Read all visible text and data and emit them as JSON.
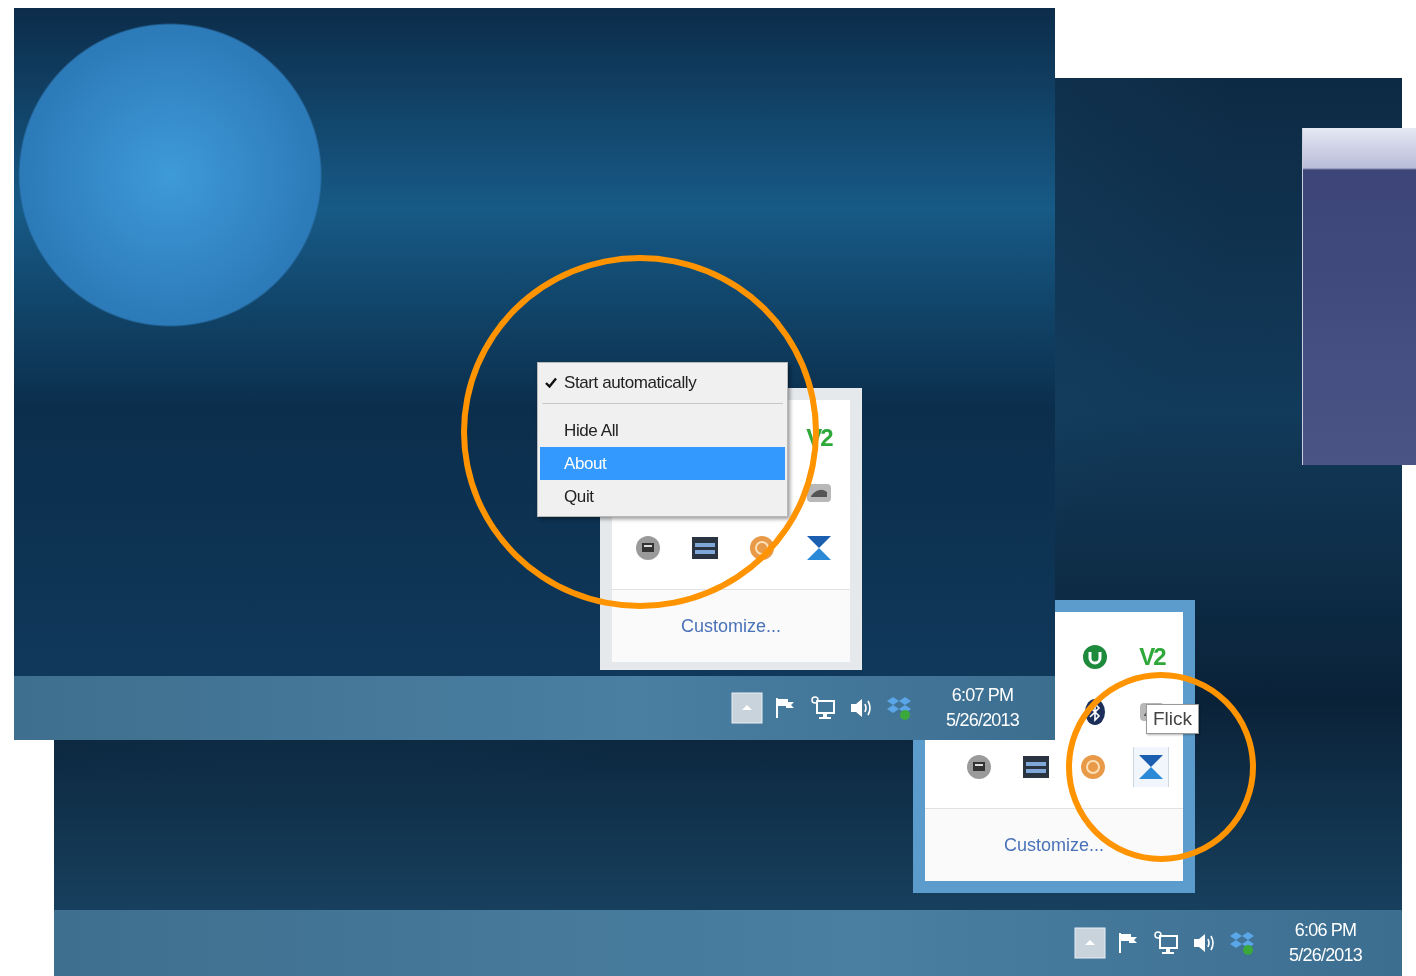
{
  "front_screenshot": {
    "context_menu": {
      "items": [
        {
          "kind": "check",
          "label": "Start automatically",
          "checked": true,
          "selected": false
        },
        {
          "kind": "separator"
        },
        {
          "kind": "command",
          "label": "Hide All",
          "selected": false
        },
        {
          "kind": "command",
          "label": "About",
          "selected": true
        },
        {
          "kind": "command",
          "label": "Quit",
          "selected": false
        }
      ]
    },
    "tray_overflow": {
      "rows": [
        [
          {
            "kind": "v2",
            "label": "V2",
            "hovered": false
          }
        ],
        [
          {
            "kind": "drive",
            "hovered": false
          }
        ],
        [
          {
            "kind": "disc",
            "hovered": false
          },
          {
            "kind": "film",
            "hovered": false
          },
          {
            "kind": "coin",
            "hovered": false
          },
          {
            "kind": "flick",
            "hovered": false
          }
        ]
      ],
      "link": "Customize..."
    },
    "taskbar": {
      "tray_icons": [
        {
          "kind": "arrow"
        },
        {
          "kind": "flag"
        },
        {
          "kind": "network"
        },
        {
          "kind": "speaker"
        },
        {
          "kind": "dropbox"
        }
      ],
      "time": "6:07 PM",
      "date": "5/26/2013"
    }
  },
  "back_screenshot": {
    "tray_overflow": {
      "rows": [
        [
          {
            "kind": "torrent",
            "hovered": false
          },
          {
            "kind": "v2",
            "label": "V2",
            "hovered": false
          }
        ],
        [
          {
            "kind": "bluetooth",
            "hovered": false
          },
          {
            "kind": "drive",
            "hovered": false
          }
        ],
        [
          {
            "kind": "disc",
            "hovered": false
          },
          {
            "kind": "film",
            "hovered": false
          },
          {
            "kind": "coin",
            "hovered": false
          },
          {
            "kind": "flick",
            "hovered": true
          }
        ]
      ],
      "tooltip": "Flick",
      "link": "Customize..."
    },
    "taskbar": {
      "tray_icons": [
        {
          "kind": "arrow"
        },
        {
          "kind": "flag"
        },
        {
          "kind": "network"
        },
        {
          "kind": "speaker"
        },
        {
          "kind": "dropbox"
        }
      ],
      "time": "6:06 PM",
      "date": "5/26/2013"
    }
  }
}
